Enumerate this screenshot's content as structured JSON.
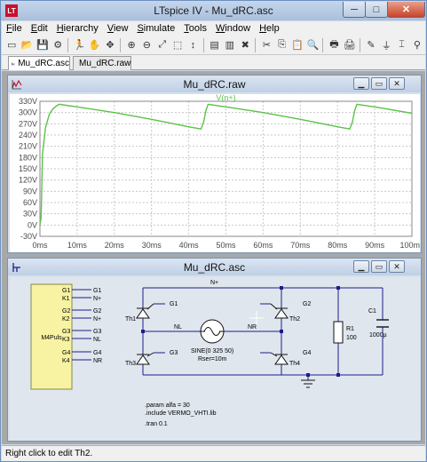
{
  "window": {
    "title": "LTspice IV - Mu_dRC.asc",
    "minimize_glyph": "─",
    "maximize_glyph": "□",
    "close_glyph": "✕"
  },
  "menu": {
    "items": [
      {
        "label": "File",
        "key": "F",
        "rest": "ile"
      },
      {
        "label": "Edit",
        "key": "E",
        "rest": "dit"
      },
      {
        "label": "Hierarchy",
        "key": "H",
        "rest": "ierarchy"
      },
      {
        "label": "View",
        "key": "V",
        "rest": "iew"
      },
      {
        "label": "Simulate",
        "key": "S",
        "rest": "imulate"
      },
      {
        "label": "Tools",
        "key": "T",
        "rest": "ools"
      },
      {
        "label": "Window",
        "key": "W",
        "rest": "indow"
      },
      {
        "label": "Help",
        "key": "H",
        "rest": "elp"
      }
    ]
  },
  "toolbar": {
    "icons": [
      "new-schematic-icon",
      "open-icon",
      "save-icon",
      "control-panel-icon",
      "run-icon",
      "halt-icon",
      "pan-icon",
      "zoom-in-icon",
      "zoom-out-icon",
      "zoom-fit-icon",
      "zoom-area-icon",
      "autorange-icon",
      "tile-horizontal-icon",
      "tile-vertical-icon",
      "close-window-icon",
      "cut-icon",
      "copy-icon",
      "paste-icon",
      "find-icon",
      "print-icon",
      "print-setup-icon",
      "wire-icon",
      "ground-icon",
      "label-net-icon",
      "component-icon"
    ]
  },
  "tabs": [
    {
      "label": "Mu_dRC.asc",
      "icon": "schematic-icon"
    },
    {
      "label": "Mu_dRC.raw",
      "icon": "waveform-icon"
    }
  ],
  "plot_window": {
    "title": "Mu_dRC.raw",
    "icon": "waveform-icon",
    "trace_label": "V(n+)"
  },
  "schematic_window": {
    "title": "Mu_dRC.asc",
    "icon": "schematic-icon",
    "block": {
      "name": "M4Puls",
      "pins": [
        {
          "pin": "G1",
          "net": "G1"
        },
        {
          "pin": "K1",
          "net": "N+"
        },
        {
          "pin": "G2",
          "net": "G2"
        },
        {
          "pin": "K2",
          "net": "N+"
        },
        {
          "pin": "G3",
          "net": "G3"
        },
        {
          "pin": "K3",
          "net": "NL"
        },
        {
          "pin": "G4",
          "net": "G4"
        },
        {
          "pin": "K4",
          "net": "NR"
        }
      ]
    },
    "nets": {
      "top": "N+",
      "left_mid": "NL",
      "right_mid": "NR"
    },
    "thyristors": [
      {
        "ref": "Th1",
        "gate": "G1"
      },
      {
        "ref": "Th2",
        "gate": "G2"
      },
      {
        "ref": "Th3",
        "gate": "G3"
      },
      {
        "ref": "Th4",
        "gate": "G4"
      }
    ],
    "source": {
      "value": "SINE(0 325 50)",
      "rser": "Rser=10m"
    },
    "resistor": {
      "ref": "R1",
      "value": "100"
    },
    "capacitor": {
      "ref": "C1",
      "value": "1000µ"
    },
    "directives": [
      ".param alfa = 30",
      ".include VERMO_VHTI.lib",
      ".tran 0.1"
    ]
  },
  "status": {
    "text": "Right click to edit Th2."
  },
  "colors": {
    "trace": "#5cc24a",
    "grid": "#c8c8c8",
    "wire": "#1d1d8a",
    "titlebar": "#bfd0e5"
  },
  "chart_data": {
    "type": "line",
    "title": "",
    "xlabel": "",
    "ylabel": "",
    "xlim": [
      0,
      100
    ],
    "ylim": [
      -30,
      330
    ],
    "x_tick_labels": [
      "0ms",
      "10ms",
      "20ms",
      "30ms",
      "40ms",
      "50ms",
      "60ms",
      "70ms",
      "80ms",
      "90ms",
      "100ms"
    ],
    "y_tick_labels": [
      "330V",
      "300V",
      "270V",
      "240V",
      "210V",
      "180V",
      "150V",
      "120V",
      "90V",
      "60V",
      "30V",
      "0V",
      "-30V"
    ],
    "grid": true,
    "series": [
      {
        "name": "V(n+)",
        "x": [
          0,
          0.3,
          0.7,
          1.5,
          2.5,
          3.5,
          4.5,
          5.2,
          10,
          20,
          30,
          40,
          43.3,
          44.0,
          44.6,
          45.2,
          50,
          60,
          70,
          80,
          83.3,
          84.0,
          84.6,
          85.2,
          90,
          100
        ],
        "y": [
          0,
          20,
          190,
          260,
          295,
          310,
          318,
          322,
          315,
          300,
          282,
          262,
          256,
          275,
          305,
          322,
          315,
          300,
          282,
          262,
          256,
          275,
          305,
          322,
          315,
          298
        ]
      }
    ]
  }
}
